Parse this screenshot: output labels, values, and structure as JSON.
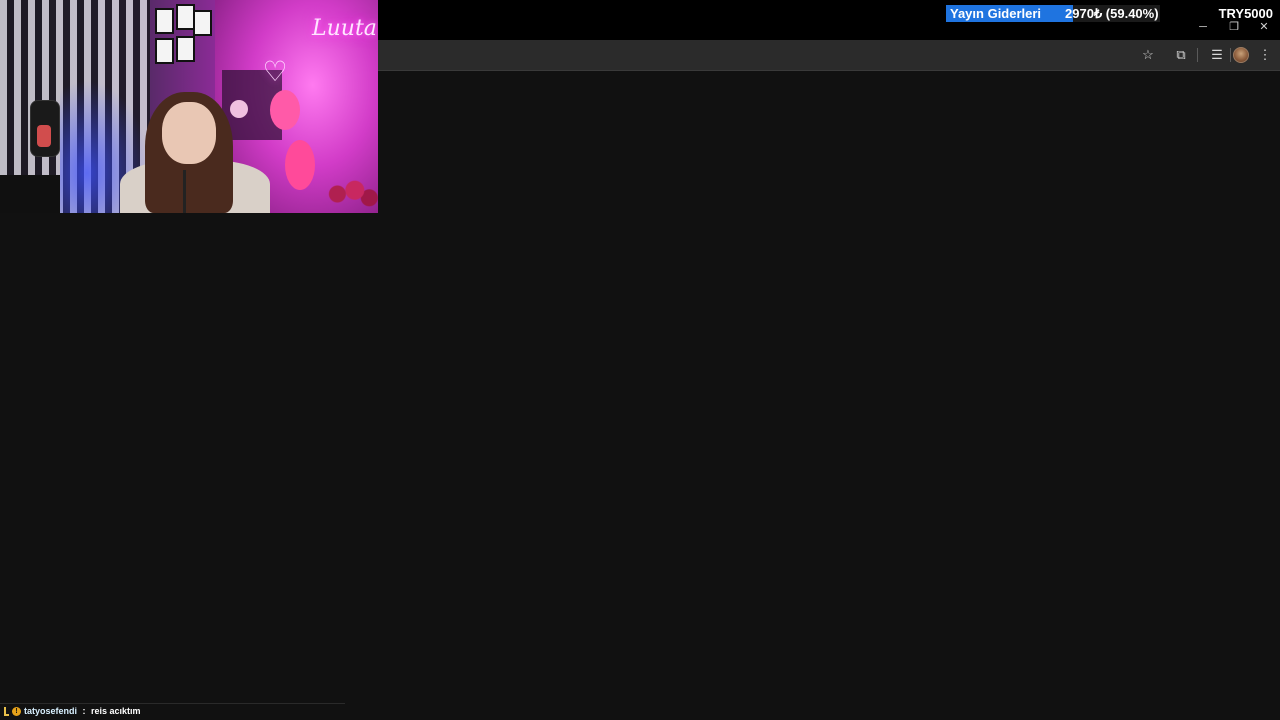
{
  "overlay_goal": {
    "label": "Yayın Giderleri",
    "amount_text": "2970₺ (59.40%)",
    "target_text": "TRY5000",
    "progress_percent": 59.4,
    "fill_color": "#1f74e0"
  },
  "webcam": {
    "neon_sign_text": "Luuta"
  },
  "browser_toolbar": {
    "icons": [
      "star-icon",
      "extensions-icon",
      "media-controls-icon",
      "profile-avatar",
      "more-menu-icon"
    ],
    "star_glyph": "☆",
    "extensions_glyph": "⧉",
    "media_glyph": "☰",
    "more_glyph": "⋮"
  },
  "window_controls": {
    "minimize": "─",
    "restore": "❐",
    "close": "✕"
  },
  "chat": {
    "username": "tatyosefendi",
    "separator": " : ",
    "message": "reis acıktım",
    "badge_glyph": "!"
  },
  "colors": {
    "page_background": "#111111",
    "toolbar_background": "#2b2b2b",
    "titlebar_background": "#000000"
  }
}
